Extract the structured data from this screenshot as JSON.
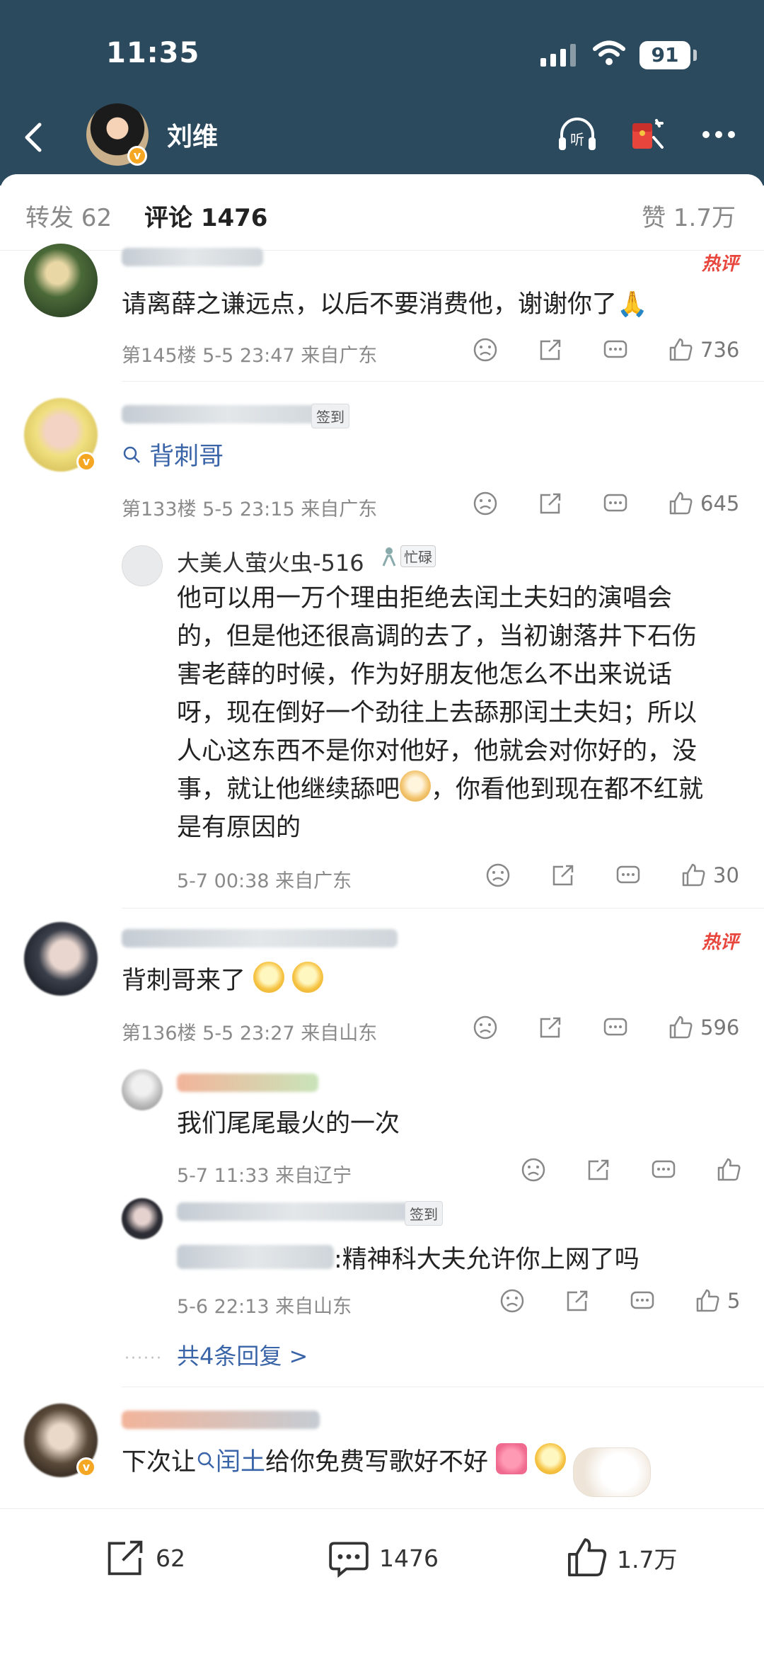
{
  "status_bar": {
    "time": "11:35",
    "battery": "91"
  },
  "header": {
    "title": "刘维"
  },
  "tabs": {
    "repost": "转发 62",
    "comments": "评论 1476",
    "likes": "赞 1.7万"
  },
  "hot_label": "热评",
  "checkin_label": "签到",
  "comments": [
    {
      "text": "请离薛之谦远点，以后不要消费他，谢谢你了🙏",
      "floor": "第145楼",
      "time": "5-5 23:47",
      "location": "来自广东",
      "likes": "736"
    },
    {
      "link": "背刺哥",
      "floor": "第133楼",
      "time": "5-5 23:15",
      "location": "来自广东",
      "likes": "645",
      "reply": {
        "name": "大美人萤火虫-516",
        "badge": "忙碌",
        "lines": [
          "他可以用一万个理由拒绝去闰土夫妇的演唱会",
          "的，但是他还很高调的去了，当初谢落井下石伤",
          "害老薛的时候，作为好朋友他怎么不出来说话",
          "呀，现在倒好一个劲往上去舔那闰土夫妇；所以",
          "人心这东西不是你对他好，他就会对你好的，没",
          "事，就让他继续舔吧",
          "，你看他到现在都不红就",
          "是有原因的"
        ],
        "time": "5-7 00:38",
        "location": "来自广东",
        "likes": "30"
      }
    },
    {
      "text": "背刺哥来了",
      "floor": "第136楼",
      "time": "5-5 23:27",
      "location": "来自山东",
      "likes": "596",
      "replies": [
        {
          "text": "我们尾尾最火的一次",
          "time": "5-7 11:33",
          "location": "来自辽宁",
          "likes": ""
        },
        {
          "text": ":精神科大夫允许你上网了吗",
          "time": "5-6 22:13",
          "location": "来自山东",
          "likes": "5"
        }
      ],
      "more": "共4条回复 >"
    },
    {
      "text_before": "下次让",
      "link": "闰土",
      "text_after": "给你免费写歌好不好"
    }
  ],
  "bottom": {
    "repost": "62",
    "comments": "1476",
    "likes": "1.7万"
  },
  "icons": {
    "back": "chevron-left-icon",
    "listen": "headphones-icon",
    "red_packet": "red-packet-icon",
    "more": "more-dots-icon",
    "dislike": "frown-icon",
    "share": "share-icon",
    "comment": "comment-icon",
    "like": "thumbs-up-icon"
  },
  "colors": {
    "header_bg": "#2c4a5e",
    "link": "#3a64a8",
    "hot": "#e8463c",
    "vip": "#f5a623"
  }
}
